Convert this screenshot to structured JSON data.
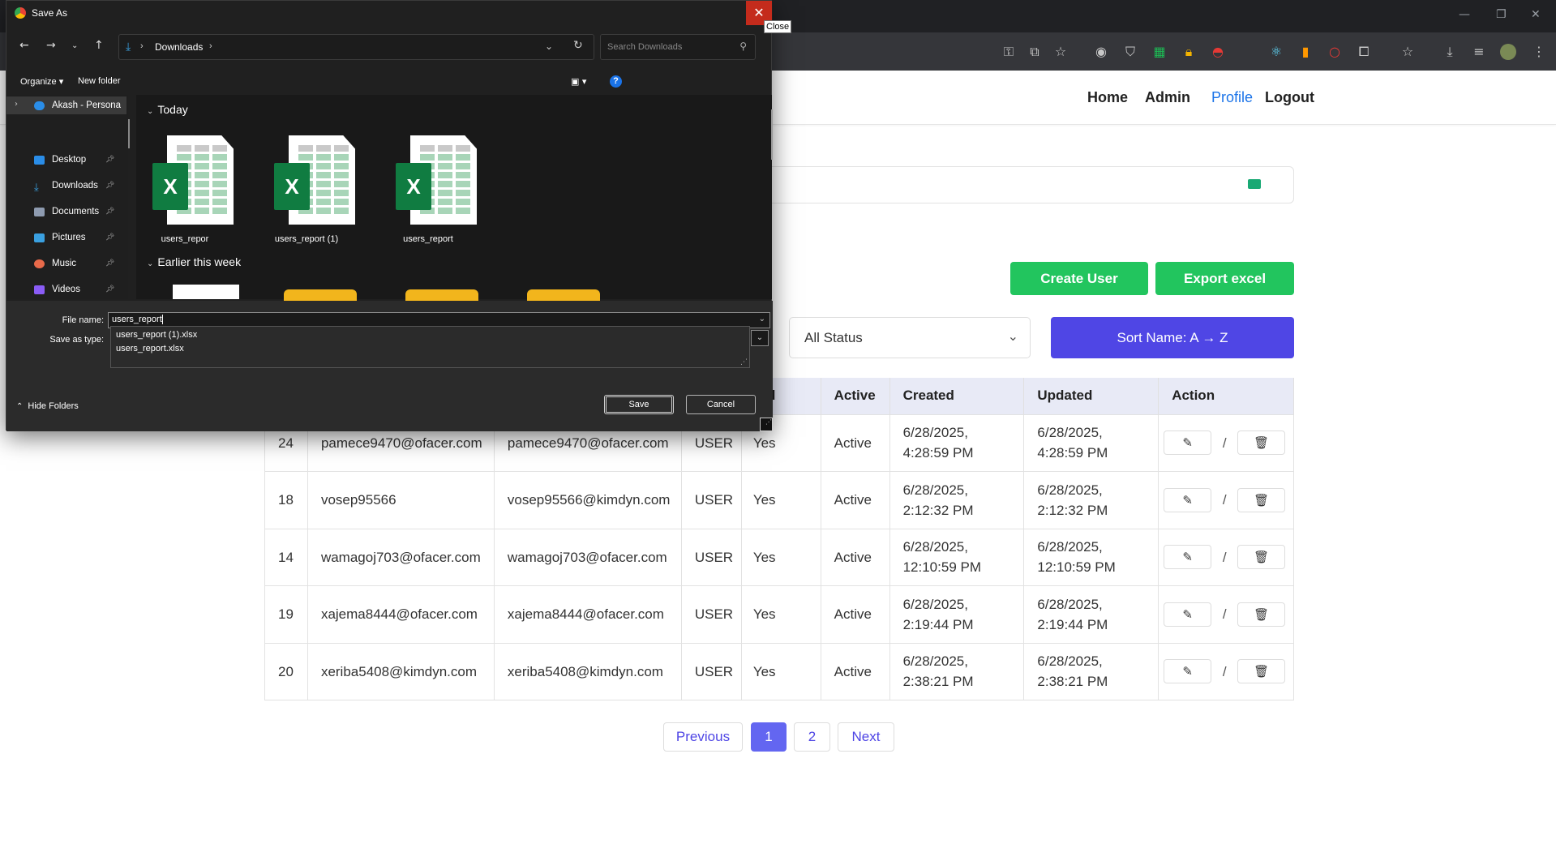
{
  "browser": {
    "toolbar_icons": [
      "key-icon",
      "install-icon",
      "star-icon",
      "camera-icon",
      "shield-icon",
      "sheet-icon",
      "lock-icon",
      "pokeball-icon",
      "react-icon",
      "lighthouse-icon",
      "record-icon",
      "extensions-icon",
      "bookmarks-icon",
      "download-icon",
      "media-icon",
      "profile-avatar"
    ]
  },
  "nav": {
    "home": "Home",
    "admin": "Admin",
    "profile": "Profile",
    "logout": "Logout"
  },
  "toolbar": {
    "create_user": "Create User",
    "export_excel": "Export excel",
    "status_filter": "All Status",
    "sort_button": "Sort Name: A → Z"
  },
  "table": {
    "headers": [
      "rified",
      "Active",
      "Created",
      "Updated",
      "Action"
    ],
    "rows": [
      {
        "id": "24",
        "username": "pamece9470@ofacer.com",
        "email": "pamece9470@ofacer.com",
        "role": "USER",
        "verified": "Yes",
        "active": "Active",
        "created_date": "6/28/2025,",
        "created_time": "4:28:59 PM",
        "updated_date": "6/28/2025,",
        "updated_time": "4:28:59 PM"
      },
      {
        "id": "18",
        "username": "vosep95566",
        "email": "vosep95566@kimdyn.com",
        "role": "USER",
        "verified": "Yes",
        "active": "Active",
        "created_date": "6/28/2025,",
        "created_time": "2:12:32 PM",
        "updated_date": "6/28/2025,",
        "updated_time": "2:12:32 PM"
      },
      {
        "id": "14",
        "username": "wamagoj703@ofacer.com",
        "email": "wamagoj703@ofacer.com",
        "role": "USER",
        "verified": "Yes",
        "active": "Active",
        "created_date": "6/28/2025,",
        "created_time": "12:10:59 PM",
        "updated_date": "6/28/2025,",
        "updated_time": "12:10:59 PM"
      },
      {
        "id": "19",
        "username": "xajema8444@ofacer.com",
        "email": "xajema8444@ofacer.com",
        "role": "USER",
        "verified": "Yes",
        "active": "Active",
        "created_date": "6/28/2025,",
        "created_time": "2:19:44 PM",
        "updated_date": "6/28/2025,",
        "updated_time": "2:19:44 PM"
      },
      {
        "id": "20",
        "username": "xeriba5408@kimdyn.com",
        "email": "xeriba5408@kimdyn.com",
        "role": "USER",
        "verified": "Yes",
        "active": "Active",
        "created_date": "6/28/2025,",
        "created_time": "2:38:21 PM",
        "updated_date": "6/28/2025,",
        "updated_time": "2:38:21 PM"
      }
    ],
    "action_separator": "/"
  },
  "pagination": {
    "previous": "Previous",
    "pages": [
      "1",
      "2"
    ],
    "current": "1",
    "next": "Next"
  },
  "dialog": {
    "title": "Save As",
    "close_tooltip": "Close",
    "location": "Downloads",
    "search_placeholder": "Search Downloads",
    "organize": "Organize",
    "new_folder": "New folder",
    "nav_items": [
      "Akash - Persona",
      "Desktop",
      "Downloads",
      "Documents",
      "Pictures",
      "Music",
      "Videos"
    ],
    "groups": {
      "today": "Today",
      "earlier": "Earlier this week"
    },
    "files": [
      "users_repor",
      "users_report (1)",
      "users_report"
    ],
    "file_name_label": "File name:",
    "file_name_value": "users_report",
    "save_as_type_label": "Save as type:",
    "suggestions": [
      "users_report (1).xlsx",
      "users_report.xlsx"
    ],
    "hide_folders": "Hide Folders",
    "save": "Save",
    "cancel": "Cancel"
  },
  "colors": {
    "accent_green": "#22c55e",
    "accent_indigo": "#4f46e5",
    "link_blue": "#1a73e8",
    "close_red": "#c42b1c"
  }
}
